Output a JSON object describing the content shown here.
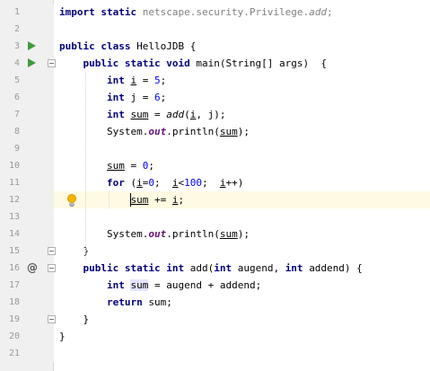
{
  "editor": {
    "lines": [
      {
        "n": "1",
        "tokens": [
          {
            "t": "import static ",
            "c": "kw"
          },
          {
            "t": "netscape.security.Privilege.",
            "c": "gray"
          },
          {
            "t": "add",
            "c": "gray stat"
          },
          {
            "t": ";",
            "c": "gray"
          }
        ]
      },
      {
        "n": "2",
        "tokens": []
      },
      {
        "n": "3",
        "tokens": [
          {
            "t": "public class ",
            "c": "kw"
          },
          {
            "t": "HelloJDB {",
            "c": ""
          }
        ]
      },
      {
        "n": "4",
        "tokens": [
          {
            "t": "    public static void ",
            "c": "kw"
          },
          {
            "t": "main(String[] args)  {",
            "c": ""
          }
        ]
      },
      {
        "n": "5",
        "tokens": [
          {
            "t": "        int ",
            "c": "kw"
          },
          {
            "t": "i",
            "c": "ul"
          },
          {
            "t": " = ",
            "c": ""
          },
          {
            "t": "5",
            "c": "num"
          },
          {
            "t": ";",
            "c": ""
          }
        ]
      },
      {
        "n": "6",
        "tokens": [
          {
            "t": "        int ",
            "c": "kw"
          },
          {
            "t": "j = ",
            "c": ""
          },
          {
            "t": "6",
            "c": "num"
          },
          {
            "t": ";",
            "c": ""
          }
        ]
      },
      {
        "n": "7",
        "tokens": [
          {
            "t": "        int ",
            "c": "kw"
          },
          {
            "t": "sum",
            "c": "ul"
          },
          {
            "t": " = ",
            "c": ""
          },
          {
            "t": "add",
            "c": "stat"
          },
          {
            "t": "(",
            "c": ""
          },
          {
            "t": "i",
            "c": "ul"
          },
          {
            "t": ", j);",
            "c": ""
          }
        ]
      },
      {
        "n": "8",
        "tokens": [
          {
            "t": "        System.",
            "c": ""
          },
          {
            "t": "out",
            "c": "field"
          },
          {
            "t": ".println(",
            "c": ""
          },
          {
            "t": "sum",
            "c": "ul"
          },
          {
            "t": ");",
            "c": ""
          }
        ]
      },
      {
        "n": "9",
        "tokens": []
      },
      {
        "n": "10",
        "tokens": [
          {
            "t": "        ",
            "c": ""
          },
          {
            "t": "sum",
            "c": "ul"
          },
          {
            "t": " = ",
            "c": ""
          },
          {
            "t": "0",
            "c": "num"
          },
          {
            "t": ";",
            "c": ""
          }
        ]
      },
      {
        "n": "11",
        "tokens": [
          {
            "t": "        for ",
            "c": "kw"
          },
          {
            "t": "(",
            "c": ""
          },
          {
            "t": "i",
            "c": "ul"
          },
          {
            "t": "=",
            "c": ""
          },
          {
            "t": "0",
            "c": "num"
          },
          {
            "t": ";  ",
            "c": ""
          },
          {
            "t": "i",
            "c": "ul"
          },
          {
            "t": "<",
            "c": ""
          },
          {
            "t": "100",
            "c": "num"
          },
          {
            "t": ";  ",
            "c": ""
          },
          {
            "t": "i",
            "c": "ul"
          },
          {
            "t": "++)",
            "c": ""
          }
        ]
      },
      {
        "n": "12",
        "tokens": [
          {
            "t": "            ",
            "c": ""
          },
          {
            "t": "sum",
            "c": "ul"
          },
          {
            "t": " += ",
            "c": ""
          },
          {
            "t": "i",
            "c": "ul"
          },
          {
            "t": ";",
            "c": ""
          }
        ]
      },
      {
        "n": "13",
        "tokens": []
      },
      {
        "n": "14",
        "tokens": [
          {
            "t": "        System.",
            "c": ""
          },
          {
            "t": "out",
            "c": "field"
          },
          {
            "t": ".println(",
            "c": ""
          },
          {
            "t": "sum",
            "c": "ul"
          },
          {
            "t": ");",
            "c": ""
          }
        ]
      },
      {
        "n": "15",
        "tokens": [
          {
            "t": "    }",
            "c": ""
          }
        ]
      },
      {
        "n": "16",
        "tokens": [
          {
            "t": "    public static int ",
            "c": "kw"
          },
          {
            "t": "add(",
            "c": ""
          },
          {
            "t": "int ",
            "c": "kw"
          },
          {
            "t": "augend, ",
            "c": ""
          },
          {
            "t": "int ",
            "c": "kw"
          },
          {
            "t": "addend) {",
            "c": ""
          }
        ]
      },
      {
        "n": "17",
        "tokens": [
          {
            "t": "        int ",
            "c": "kw"
          },
          {
            "t": "sum",
            "c": "hl"
          },
          {
            "t": " = augend + addend;",
            "c": ""
          }
        ]
      },
      {
        "n": "18",
        "tokens": [
          {
            "t": "        return ",
            "c": "kw"
          },
          {
            "t": "sum;",
            "c": ""
          }
        ]
      },
      {
        "n": "19",
        "tokens": [
          {
            "t": "    }",
            "c": ""
          }
        ]
      },
      {
        "n": "20",
        "tokens": [
          {
            "t": "}",
            "c": ""
          }
        ]
      },
      {
        "n": "21",
        "tokens": []
      }
    ],
    "caret_line": "12",
    "run_markers": [
      "3",
      "4"
    ],
    "override_marker_line": "16",
    "override_marker_icon": "at-sign-icon",
    "intention_bulb_line": "12",
    "fold_marker_lines": [
      "4",
      "15",
      "16",
      "19"
    ],
    "colors": {
      "keyword": "#000080",
      "number": "#0000ff",
      "static_field": "#660e7a",
      "caret_row": "#fffae3",
      "gutter": "#f0f0f0",
      "run_icon": "#3c9c3a"
    }
  }
}
